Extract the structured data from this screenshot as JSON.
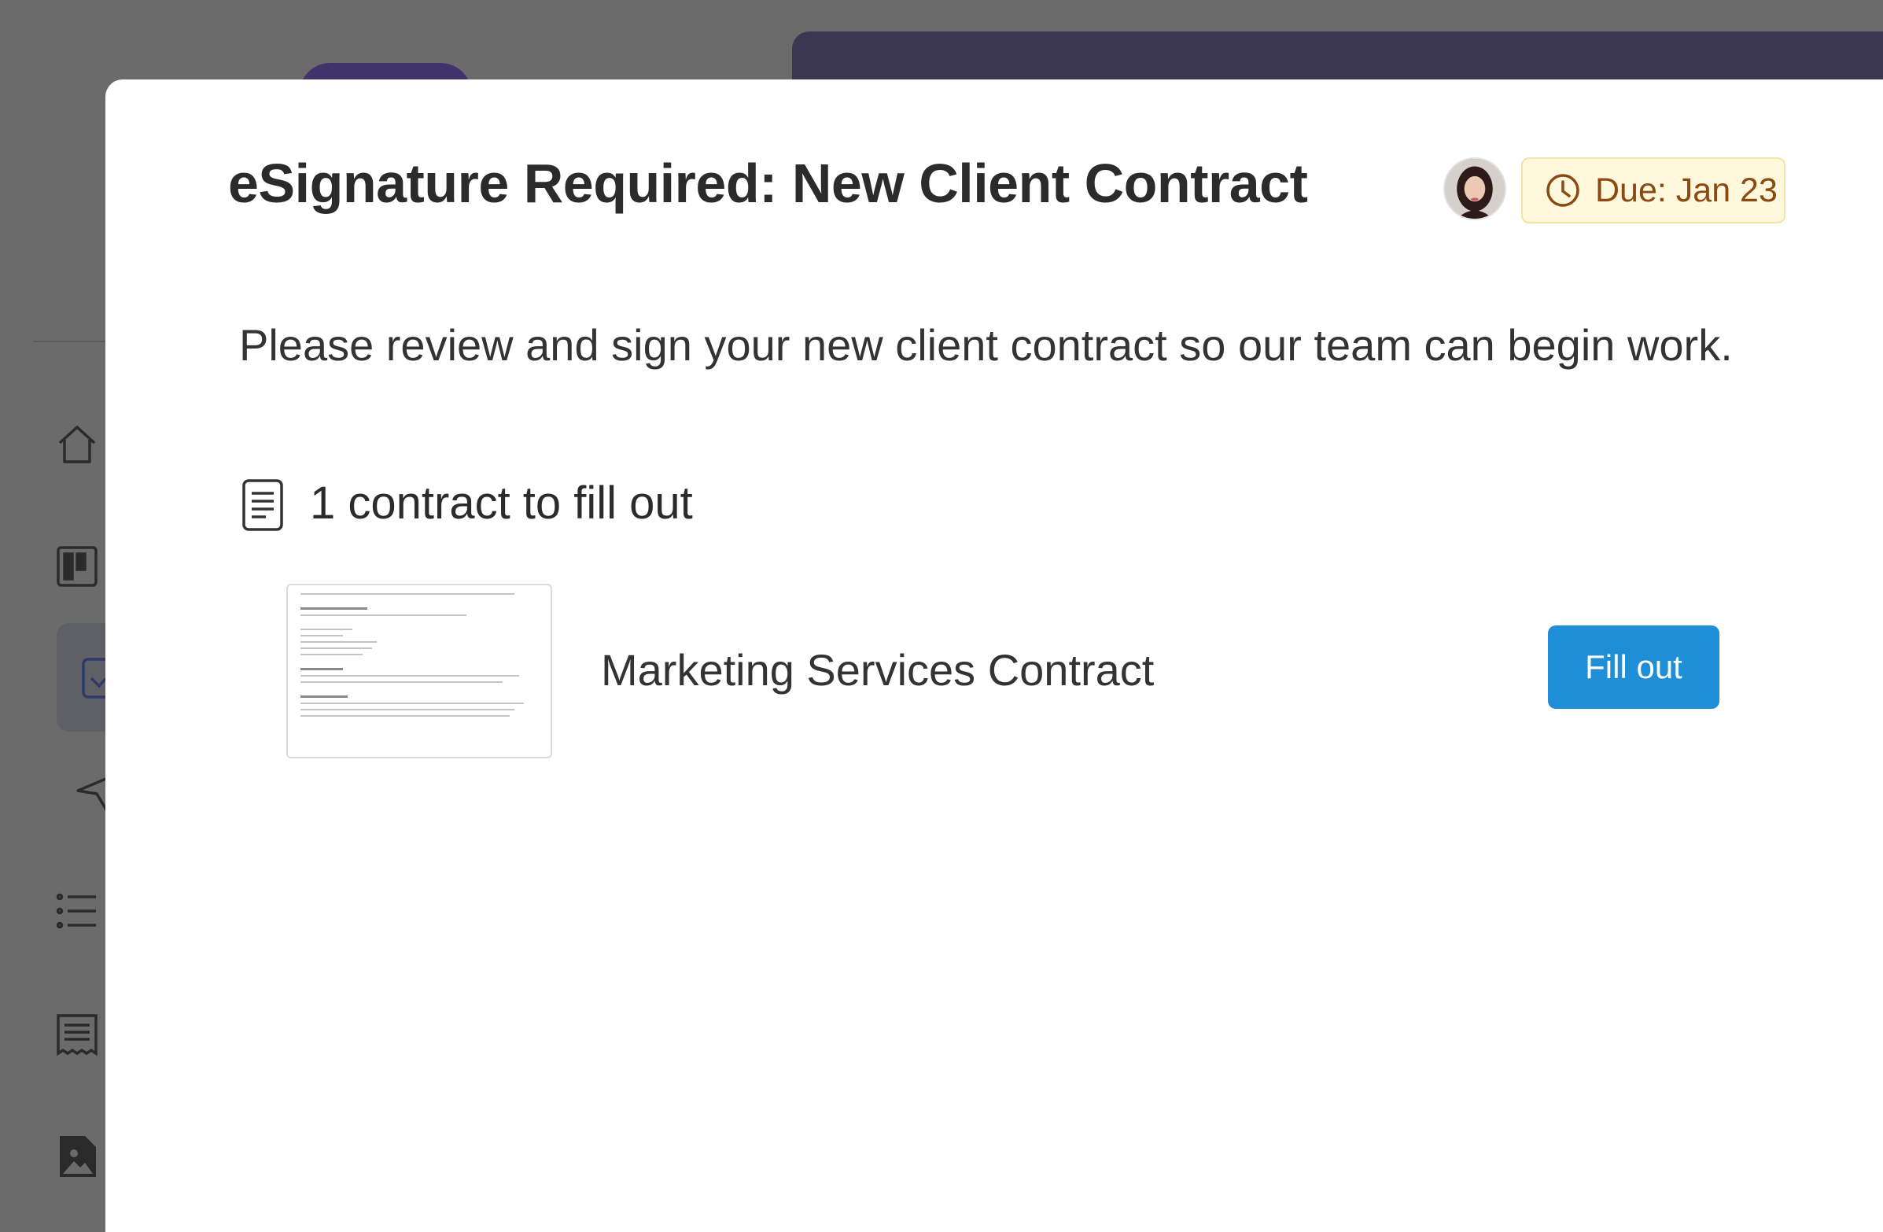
{
  "modal": {
    "title": "eSignature Required: New Client Contract",
    "due_label": "Due: Jan 23",
    "description": "Please review and sign your new client contract so our team can begin work.",
    "section_heading": "1 contract to fill out",
    "contract": {
      "name": "Marketing Services Contract",
      "action_label": "Fill out"
    }
  },
  "colors": {
    "primary_button": "#1e8fd6",
    "due_badge_bg": "#fff8dc",
    "due_badge_text": "#8a4a12",
    "overlay": "#6b6b6b",
    "topbar": "#3b3752"
  },
  "icons": {
    "due": "clock-icon",
    "section": "document-icon",
    "sidebar": [
      "home-icon",
      "board-icon",
      "checkbox-icon",
      "send-icon",
      "list-icon",
      "receipt-icon",
      "image-file-icon"
    ]
  }
}
